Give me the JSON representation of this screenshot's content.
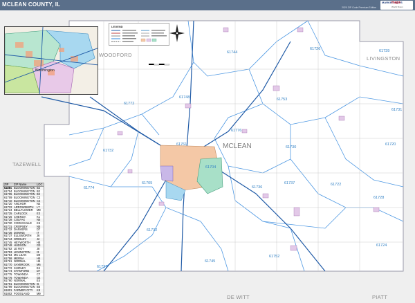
{
  "header": {
    "title": "MCLEAN COUNTY, IL",
    "edition": "2020 ZIP Code Premium Edition",
    "logo_line1": "MARKET MAPS",
    "logo_line2": "maps",
    "logo_line3": "World Vision"
  },
  "counties": {
    "main": "MCLEAN",
    "neighbors": [
      "WOODFORD",
      "LIVINGSTON",
      "TAZEWELL",
      "DE WITT",
      "PIATT"
    ]
  },
  "zip_labels": {
    "z61744": "61744",
    "z61726": "61726",
    "z61739": "61739",
    "z61748": "61748",
    "z61772a": "61772",
    "z61753": "61753",
    "z61776": "61776",
    "z61730": "61730",
    "z61731": "61731",
    "z61732": "61732",
    "z61720": "61720",
    "z61774": "61774",
    "z61705": "61705",
    "z61737": "61737",
    "z61722": "61722",
    "z61736": "61736",
    "z61728": "61728",
    "z61752": "61752",
    "z61724": "61724",
    "z61745": "61745",
    "z61727": "61727",
    "z61732b": "61732",
    "z61704": "61704",
    "z61761": "61761"
  },
  "inset": {
    "city": "Bloomington"
  },
  "legend": {
    "title": "LEGEND"
  },
  "zip_table": {
    "headers": [
      "ZIP Code",
      "ZIP Name",
      "LOC"
    ],
    "rows": [
      [
        "61701",
        "BLOOMINGTON",
        "B2"
      ],
      [
        "61704",
        "BLOOMINGTON",
        "B2"
      ],
      [
        "61705",
        "BLOOMINGTON",
        "B2"
      ],
      [
        "61709",
        "BLOOMINGTON",
        "C2"
      ],
      [
        "61710",
        "BLOOMINGTON",
        "C2"
      ],
      [
        "61720",
        "ANCHOR",
        "N4"
      ],
      [
        "61722",
        "ARROWSMITH",
        "L7"
      ],
      [
        "61724",
        "BELLFLOWER",
        "M8"
      ],
      [
        "61725",
        "CARLOCK",
        "E3"
      ],
      [
        "61726",
        "CHENOA",
        "K1"
      ],
      [
        "61728",
        "COLFAX",
        "N5"
      ],
      [
        "61730",
        "COOKSVILLE",
        "K5"
      ],
      [
        "61731",
        "CROPSEY",
        "N5"
      ],
      [
        "61732",
        "DANVERS",
        "D7"
      ],
      [
        "61736",
        "DOWNS",
        "I7"
      ],
      [
        "61737",
        "ELLSWORTH",
        "J6"
      ],
      [
        "61744",
        "GRIDLEY",
        "J2"
      ],
      [
        "61745",
        "HEYWORTH",
        "H8"
      ],
      [
        "61748",
        "HUDSON",
        "G3"
      ],
      [
        "61752",
        "LE ROY",
        "J8"
      ],
      [
        "61753",
        "LEXINGTON",
        "I3"
      ],
      [
        "61754",
        "MC LEAN",
        "D9"
      ],
      [
        "61758",
        "MERNA",
        "H5"
      ],
      [
        "61761",
        "NORMAL",
        "H5"
      ],
      [
        "61770",
        "SAYBROOK",
        "M6"
      ],
      [
        "61772",
        "SHIRLEY",
        "E4"
      ],
      [
        "61774",
        "STANFORD",
        "D7"
      ],
      [
        "61775",
        "TOWANDA",
        "C7"
      ],
      [
        "61776",
        "TOWANDA",
        "G4"
      ],
      [
        "61790",
        "NORMAL",
        "E4"
      ],
      [
        "61791",
        "BLOOMINGTON",
        "I6"
      ],
      [
        "61799",
        "BLOOMINGTON",
        "B5"
      ],
      [
        "61801",
        "FARMER CITY",
        "K8"
      ],
      [
        "61802",
        "FOOSLAND",
        "M9"
      ]
    ]
  }
}
